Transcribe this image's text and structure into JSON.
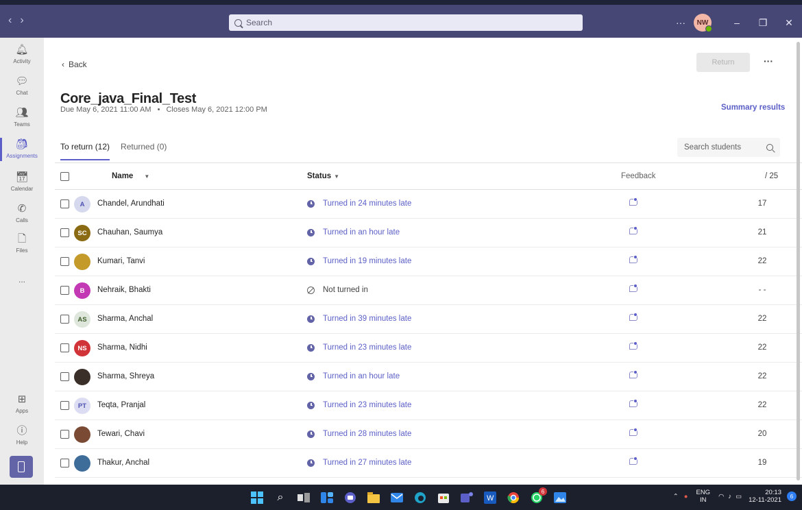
{
  "titlebar": {
    "nav_back": "‹",
    "nav_forward": "›",
    "search_placeholder": "Search",
    "more": "···",
    "avatar_initials": "NW",
    "minimize": "–",
    "maximize": "❐",
    "close": "✕"
  },
  "rail": {
    "items": [
      {
        "label": "Activity",
        "icon": "bell-icon"
      },
      {
        "label": "Chat",
        "icon": "chat-icon"
      },
      {
        "label": "Teams",
        "icon": "teams-icon"
      },
      {
        "label": "Assignments",
        "icon": "assignments-icon"
      },
      {
        "label": "Calendar",
        "icon": "calendar-icon"
      },
      {
        "label": "Calls",
        "icon": "phone-icon"
      },
      {
        "label": "Files",
        "icon": "file-icon"
      },
      {
        "label": "...",
        "icon": "more-icon"
      },
      {
        "label": "Apps",
        "icon": "apps-icon"
      },
      {
        "label": "Help",
        "icon": "help-icon"
      }
    ]
  },
  "page": {
    "back_label": "Back",
    "return_label": "Return",
    "more_label": "···",
    "title": "Core_java_Final_Test",
    "due": "Due May 6, 2021 11:00 AM",
    "bullet": "•",
    "closes": "Closes May 6, 2021 12:00 PM",
    "summary_label": "Summary results",
    "tabs": [
      {
        "label": "To return (12)",
        "active": true
      },
      {
        "label": "Returned (0)",
        "active": false
      }
    ],
    "search_students_placeholder": "Search students"
  },
  "table": {
    "headers": {
      "name": "Name",
      "status": "Status",
      "feedback": "Feedback",
      "points": "/ 25"
    },
    "rows": [
      {
        "avatar": "A",
        "avatar_color": "#d6d9ee",
        "avatar_text_color": "#4f52b2",
        "name": "Chandel, Arundhati",
        "status": "Turned in 24 minutes late",
        "late": true,
        "points": "17"
      },
      {
        "avatar": "SC",
        "avatar_color": "#8a6a12",
        "avatar_text_color": "#ffffff",
        "name": "Chauhan, Saumya",
        "status": "Turned in an hour late",
        "late": true,
        "points": "21"
      },
      {
        "avatar": "",
        "avatar_color": "#c49a2a",
        "avatar_text_color": "#ffffff",
        "name": "Kumari, Tanvi",
        "status": "Turned in 19 minutes late",
        "late": true,
        "points": "22"
      },
      {
        "avatar": "B",
        "avatar_color": "#c239b3",
        "avatar_text_color": "#ffffff",
        "name": "Nehraik, Bhakti",
        "status": "Not turned in",
        "late": false,
        "points": "- -"
      },
      {
        "avatar": "AS",
        "avatar_color": "#dfe6dc",
        "avatar_text_color": "#3f5e2c",
        "name": "Sharma, Anchal",
        "status": "Turned in 39 minutes late",
        "late": true,
        "points": "22"
      },
      {
        "avatar": "NS",
        "avatar_color": "#d13438",
        "avatar_text_color": "#ffffff",
        "name": "Sharma, Nidhi",
        "status": "Turned in 23 minutes late",
        "late": true,
        "points": "22"
      },
      {
        "avatar": "",
        "avatar_color": "#3b2f2a",
        "avatar_text_color": "#ffffff",
        "name": "Sharma, Shreya",
        "status": "Turned in an hour late",
        "late": true,
        "points": "22"
      },
      {
        "avatar": "PT",
        "avatar_color": "#dcdcf2",
        "avatar_text_color": "#4f52b2",
        "name": "Teqta, Pranjal",
        "status": "Turned in 23 minutes late",
        "late": true,
        "points": "22"
      },
      {
        "avatar": "",
        "avatar_color": "#7a4a35",
        "avatar_text_color": "#ffffff",
        "name": "Tewari, Chavi",
        "status": "Turned in 28 minutes late",
        "late": true,
        "points": "20"
      },
      {
        "avatar": "",
        "avatar_color": "#3f6d9a",
        "avatar_text_color": "#ffffff",
        "name": "Thakur, Anchal",
        "status": "Turned in 27 minutes late",
        "late": true,
        "points": "19"
      }
    ]
  },
  "taskbar": {
    "lang_top": "ENG",
    "lang_bottom": "IN",
    "time": "20:13",
    "date": "12-11-2021",
    "notifications": "6",
    "whatsapp_badge": "6"
  }
}
